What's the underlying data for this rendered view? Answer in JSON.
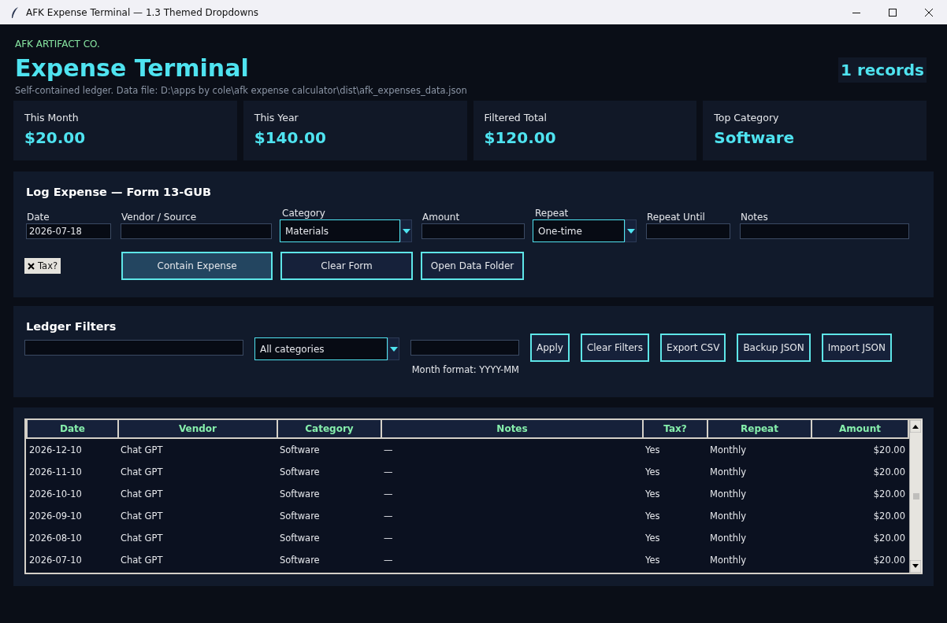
{
  "window": {
    "title": "AFK Expense Terminal — 1.3 Themed Dropdowns"
  },
  "header": {
    "brand": "AFK ARTIFACT CO.",
    "title": "Expense Terminal",
    "subtitle": "Self-contained ledger. Data file: D:\\apps by cole\\afk expense calculator\\dist\\afk_expenses_data.json",
    "record_count": "1 records"
  },
  "stats": [
    {
      "label": "This Month",
      "value": "$20.00"
    },
    {
      "label": "This Year",
      "value": "$140.00"
    },
    {
      "label": "Filtered Total",
      "value": "$120.00"
    },
    {
      "label": "Top Category",
      "value": "Software"
    }
  ],
  "form": {
    "title": "Log Expense — Form 13-GUB",
    "fields": [
      {
        "kind": "text",
        "label": "Date",
        "value": "2026-07-18"
      },
      {
        "kind": "text",
        "label": "Vendor / Source"
      },
      {
        "kind": "dropdown",
        "label": "Category",
        "value": "Materials"
      },
      {
        "kind": "text",
        "label": "Amount"
      },
      {
        "kind": "dropdown",
        "label": "Repeat",
        "value": "One-time"
      },
      {
        "kind": "text",
        "label": "Repeat Until"
      },
      {
        "kind": "text",
        "label": "Notes"
      }
    ],
    "tax": {
      "label": "Tax?",
      "checked": true
    },
    "buttons": [
      {
        "label": "Contain Expense",
        "primary": true
      },
      {
        "label": "Clear Form",
        "primary": false
      },
      {
        "label": "Open Data Folder",
        "primary": false
      }
    ]
  },
  "filters": {
    "title": "Ledger Filters",
    "controls": [
      {
        "kind": "text"
      },
      {
        "kind": "dropdown",
        "value": "All categories"
      },
      {
        "kind": "text",
        "note": "Month format: YYYY-MM"
      }
    ],
    "buttons": [
      "Apply",
      "Clear Filters",
      "Export CSV",
      "Backup JSON",
      "Import JSON"
    ]
  },
  "table": {
    "columns": [
      "Date",
      "Vendor",
      "Category",
      "Notes",
      "Tax?",
      "Repeat",
      "Amount"
    ],
    "rows": [
      [
        "2026-12-10",
        "Chat GPT",
        "Software",
        "—",
        "Yes",
        "Monthly",
        "$20.00"
      ],
      [
        "2026-11-10",
        "Chat GPT",
        "Software",
        "—",
        "Yes",
        "Monthly",
        "$20.00"
      ],
      [
        "2026-10-10",
        "Chat GPT",
        "Software",
        "—",
        "Yes",
        "Monthly",
        "$20.00"
      ],
      [
        "2026-09-10",
        "Chat GPT",
        "Software",
        "—",
        "Yes",
        "Monthly",
        "$20.00"
      ],
      [
        "2026-08-10",
        "Chat GPT",
        "Software",
        "—",
        "Yes",
        "Monthly",
        "$20.00"
      ],
      [
        "2026-07-10",
        "Chat GPT",
        "Software",
        "—",
        "Yes",
        "Monthly",
        "$20.00"
      ]
    ]
  }
}
